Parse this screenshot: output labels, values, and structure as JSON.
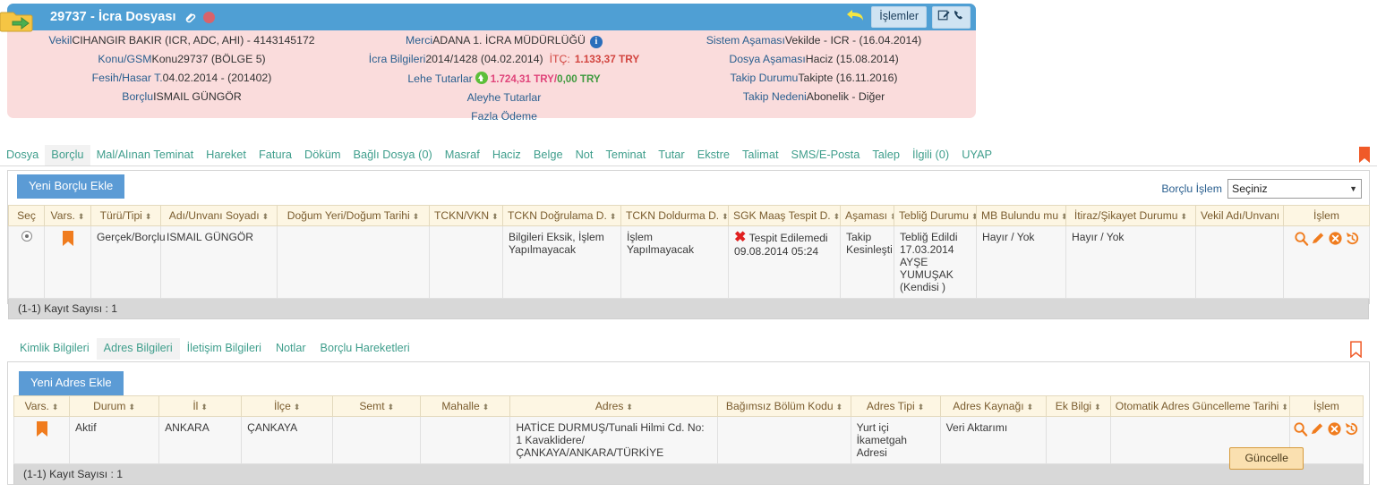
{
  "header": {
    "file_title": "29737 - İcra Dosyası",
    "folder_icon": "folder-open-icon",
    "link_icon": "paperclip-link-icon",
    "status_dot": "red-status-dot",
    "back_icon": "back-arrow-icon",
    "islemler_label": "İşlemler",
    "edit_icon": "edit-note-icon",
    "phone_icon": "phone-icon",
    "col1": [
      {
        "label": "Vekil",
        "value": "CIHANGIR BAKIR (ICR, ADC, AHI) - 4143145172"
      },
      {
        "label": "Konu/GSM",
        "value": "Konu29737 (BÖLGE 5)"
      },
      {
        "label": "Fesih/Hasar T.",
        "value": "04.02.2014 - (201402)"
      },
      {
        "label": "Borçlu",
        "value": "ISMAIL GÜNGÖR"
      }
    ],
    "col2": [
      {
        "label": "Merci",
        "value": "ADANA 1. İCRA MÜDÜRLÜĞÜ",
        "info_icon": "info-circle-icon"
      },
      {
        "label": "İcra Bilgileri",
        "value": "2014/1428 (04.02.2014)",
        "extra_label": "İTÇ:",
        "extra_value": "1.133,37 TRY"
      },
      {
        "label": "Lehe Tutarlar",
        "arrow_icon": "up-arrow-icon",
        "amount_pink": "1.724,31 TRY",
        "amount_sep": "/",
        "amount_green": "0,00 TRY"
      },
      {
        "label": "Aleyhe Tutarlar",
        "value": ""
      },
      {
        "label": "Fazla Ödeme",
        "value": ""
      }
    ],
    "col3": [
      {
        "label": "Sistem Aşaması",
        "value": "Vekilde - ICR - (16.04.2014)"
      },
      {
        "label": "Dosya Aşaması",
        "value": "Haciz (15.08.2014)"
      },
      {
        "label": "Takip Durumu",
        "value": "Takipte (16.11.2016)"
      },
      {
        "label": "Takip Nedeni",
        "value": "Abonelik - Diğer"
      }
    ]
  },
  "main_tabs": [
    {
      "label": "Dosya",
      "active": false
    },
    {
      "label": "Borçlu",
      "active": true
    },
    {
      "label": "Mal/Alınan Teminat",
      "active": false
    },
    {
      "label": "Hareket",
      "active": false
    },
    {
      "label": "Fatura",
      "active": false
    },
    {
      "label": "Döküm",
      "active": false
    },
    {
      "label": "Bağlı Dosya (0)",
      "active": false
    },
    {
      "label": "Masraf",
      "active": false
    },
    {
      "label": "Haciz",
      "active": false
    },
    {
      "label": "Belge",
      "active": false
    },
    {
      "label": "Not",
      "active": false
    },
    {
      "label": "Teminat",
      "active": false
    },
    {
      "label": "Tutar",
      "active": false
    },
    {
      "label": "Ekstre",
      "active": false
    },
    {
      "label": "Talimat",
      "active": false
    },
    {
      "label": "SMS/E-Posta",
      "active": false
    },
    {
      "label": "Talep",
      "active": false
    },
    {
      "label": "İlgili (0)",
      "active": false
    },
    {
      "label": "UYAP",
      "active": false
    }
  ],
  "bookmark_icon": "bookmark-flag-icon",
  "debtor_panel": {
    "add_button": "Yeni Borçlu Ekle",
    "operation_label": "Borçlu İşlem",
    "operation_value": "Seçiniz",
    "caret_icon": "chevron-down-icon",
    "columns": [
      "Seç",
      "Vars.",
      "Türü/Tipi",
      "Adı/Unvanı Soyadı",
      "Doğum Yeri/Doğum Tarihi",
      "TCKN/VKN",
      "TCKN Doğrulama D.",
      "TCKN Doldurma D.",
      "SGK Maaş Tespit D.",
      "Aşaması",
      "Tebliğ Durumu",
      "MB Bulundu mu",
      "İtiraz/Şikayet Durumu",
      "Vekil Adı/Unvanı",
      "İşlem"
    ],
    "row": {
      "select_icon": "radio-selected-icon",
      "default_flag_icon": "orange-bookmark-icon",
      "tur_tipi": "Gerçek/Borçlu",
      "ad_unvan": "ISMAIL GÜNGÖR",
      "dogum": "",
      "tckn_vkn": "",
      "tckn_dogrulama": "Bilgileri Eksik, İşlem Yapılmayacak",
      "tckn_doldurma": "İşlem Yapılmayacak",
      "sgk_icon": "red-x-icon",
      "sgk_maas": "Tespit Edilemedi 09.08.2014 05:24",
      "asamasi": "Takip Kesinleşti",
      "teblig_durumu": "Tebliğ Edildi 17.03.2014 AYŞE YUMUŞAK (Kendisi )",
      "mb_bulundu": "Hayır / Yok",
      "itiraz_sikayet": "Hayır / Yok",
      "vekil_adi": "",
      "ops": [
        "search-icon",
        "edit-pencil-icon",
        "delete-circle-icon",
        "history-icon"
      ]
    },
    "footer": "(1-1) Kayıt Sayısı : 1"
  },
  "sub_tabs": [
    {
      "label": "Kimlik Bilgileri",
      "active": false
    },
    {
      "label": "Adres Bilgileri",
      "active": true
    },
    {
      "label": "İletişim Bilgileri",
      "active": false
    },
    {
      "label": "Notlar",
      "active": false
    },
    {
      "label": "Borçlu Hareketleri",
      "active": false
    }
  ],
  "address_panel": {
    "add_button": "Yeni Adres Ekle",
    "columns": [
      "Vars.",
      "Durum",
      "İl",
      "İlçe",
      "Semt",
      "Mahalle",
      "Adres",
      "Bağımsız Bölüm Kodu",
      "Adres Tipi",
      "Adres Kaynağı",
      "Ek Bilgi",
      "Otomatik Adres Güncelleme Tarihi",
      "İşlem"
    ],
    "row": {
      "default_flag_icon": "orange-bookmark-icon",
      "durum": "Aktif",
      "il": "ANKARA",
      "ilce": "ÇANKAYA",
      "semt": "",
      "mahalle": "",
      "adres": "HATİCE DURMUŞ/Tunali Hilmi Cd. No: 1 Kavaklidere/ÇANKAYA/ANKARA/TÜRKİYE",
      "bagimsiz_bolum_kodu": "",
      "adres_tipi": "Yurt içi İkametgah Adresi",
      "adres_kaynagi": "Veri Aktarımı",
      "ek_bilgi": "",
      "otomatik_tarih": "",
      "ops": [
        "search-icon",
        "edit-pencil-icon",
        "delete-circle-icon",
        "history-icon"
      ]
    },
    "footer": "(1-1) Kayıt Sayısı : 1",
    "update_button": "Güncelle"
  },
  "colors": {
    "header_bar": "#4f9fd4",
    "header_body": "#fadcdc",
    "tab_text": "#3f9e8c",
    "grid_header": "#fdf6e3",
    "accent_orange": "#f07c1e",
    "button_blue": "#5b9bd5"
  }
}
